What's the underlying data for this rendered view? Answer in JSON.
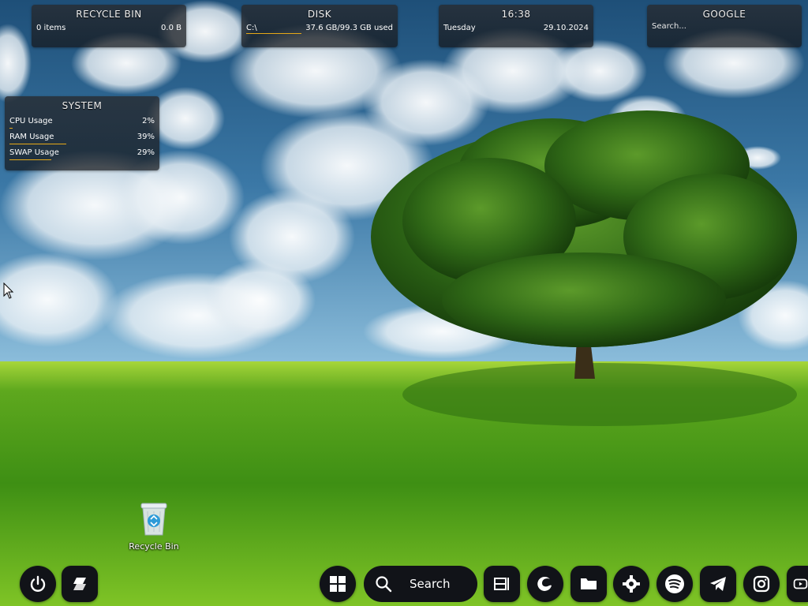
{
  "widgets": {
    "recycle_bin": {
      "title": "RECYCLE BIN",
      "items": "0 items",
      "size": "0.0 B"
    },
    "disk": {
      "title": "DISK",
      "drive": "C:\\",
      "usage": "37.6 GB/99.3 GB used",
      "used_fraction": 0.379
    },
    "clock": {
      "time": "16:38",
      "day": "Tuesday",
      "date": "29.10.2024"
    },
    "google": {
      "title": "GOOGLE",
      "placeholder": "Search..."
    },
    "system": {
      "title": "SYSTEM",
      "rows": [
        {
          "label": "CPU Usage",
          "value": "2%",
          "fraction": 0.02
        },
        {
          "label": "RAM Usage",
          "value": "39%",
          "fraction": 0.39
        },
        {
          "label": "SWAP Usage",
          "value": "29%",
          "fraction": 0.29
        }
      ]
    }
  },
  "desktop": {
    "recycle_bin_label": "Recycle Bin"
  },
  "dock": {
    "search_label": "Search",
    "left_items": [
      "power-icon",
      "app-launcher-icon"
    ],
    "right_items": [
      "windows-start-icon",
      "search-icon",
      "task-view-icon",
      "edge-icon",
      "folder-icon",
      "settings-icon",
      "spotify-icon",
      "telegram-icon",
      "instagram-icon",
      "youtube-icon"
    ]
  },
  "colors": {
    "accent": "#e6a817",
    "dock_bg": "#111318",
    "widget_bg": "#26292e"
  }
}
